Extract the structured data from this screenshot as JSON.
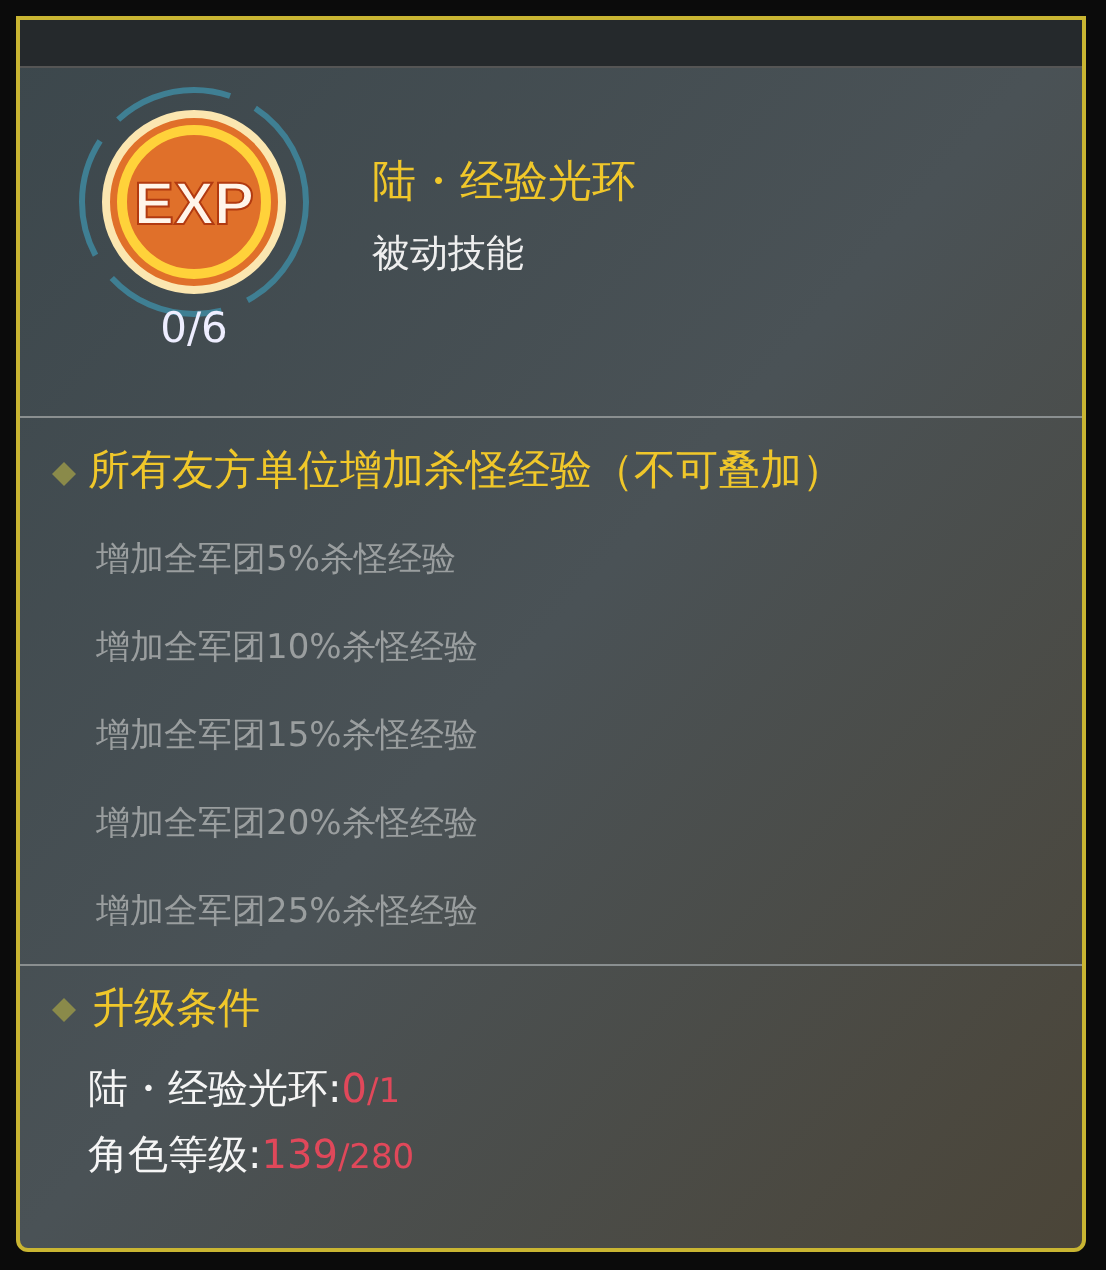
{
  "skill": {
    "icon_text": "EXP",
    "progress": "0/6",
    "name": "陆・经验光环",
    "type": "被动技能"
  },
  "effect": {
    "heading": "所有友方单位增加杀怪经验（不可叠加）",
    "levels": [
      {
        "text": "增加全军团5%杀怪经验",
        "unlocked": false
      },
      {
        "text": "增加全军团10%杀怪经验",
        "unlocked": false
      },
      {
        "text": "增加全军团15%杀怪经验",
        "unlocked": false
      },
      {
        "text": "增加全军团20%杀怪经验",
        "unlocked": false
      },
      {
        "text": "增加全军团25%杀怪经验",
        "unlocked": false
      }
    ]
  },
  "upgrade": {
    "heading": "升级条件",
    "requirements": [
      {
        "label": "陆・经验光环:",
        "current": "0",
        "required": "/1",
        "met": false
      },
      {
        "label": "角色等级:",
        "current": "139",
        "required": "/280",
        "met": false
      }
    ]
  }
}
